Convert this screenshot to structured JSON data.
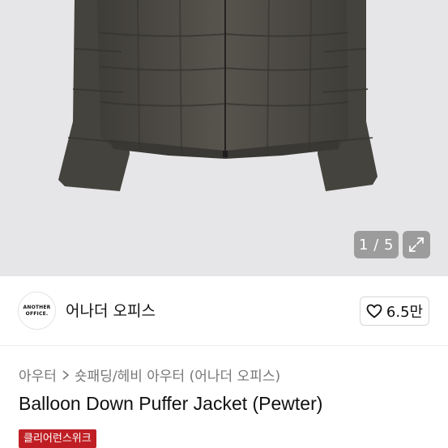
{
  "gallery": {
    "counter": "1 / 5",
    "expand_icon": "expand-icon",
    "product_color": "#4a4842"
  },
  "store": {
    "logo_line1": "ANOTHER",
    "logo_line2": "OFFICE.",
    "name": "어나더 오피스",
    "like_count": "6.5만",
    "like_icon": "heart-outline-icon"
  },
  "breadcrumb": {
    "category": "아우터",
    "separator_icon": "chevron-right-icon",
    "subcategory": "숏패딩/헤비 아우터 (어나더 오피스)"
  },
  "product": {
    "title": "Balloon Down Puffer Jacket (Pewter)",
    "badge": "클리어런스위크",
    "badge_color": "#bf1f24"
  }
}
